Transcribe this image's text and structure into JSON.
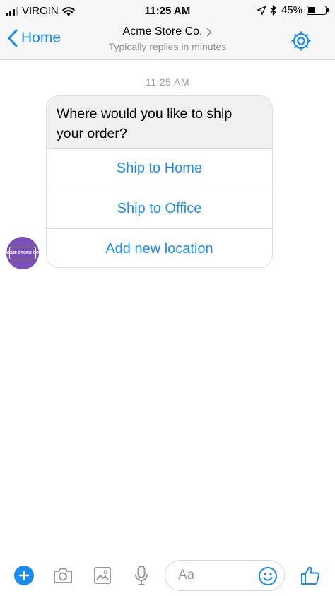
{
  "status_bar": {
    "carrier": "VIRGIN",
    "time": "11:25 AM",
    "battery": "45%",
    "battery_level": 0.45
  },
  "nav": {
    "back_label": "Home",
    "title": "Acme Store Co.",
    "subtitle": "Typically replies in minutes"
  },
  "conversation": {
    "timestamp": "11:25 AM",
    "avatar_text": "ACME STORE CO.",
    "card": {
      "prompt": "Where would you like to ship your order?",
      "options": [
        {
          "label": "Ship to Home"
        },
        {
          "label": "Ship to Office"
        },
        {
          "label": "Add new location"
        }
      ]
    }
  },
  "composer": {
    "placeholder": "Aa"
  },
  "colors": {
    "accent": "#1a8cf0",
    "avatar": "#7a50b8",
    "bubble": "#f1f0f0"
  },
  "icons": [
    "signal-icon",
    "wifi-icon",
    "location-arrow-icon",
    "bluetooth-icon",
    "battery-icon",
    "back-chevron-icon",
    "chevron-right-icon",
    "gear-icon",
    "plus-icon",
    "camera-icon",
    "gallery-icon",
    "microphone-icon",
    "emoji-icon",
    "thumbs-up-icon"
  ]
}
